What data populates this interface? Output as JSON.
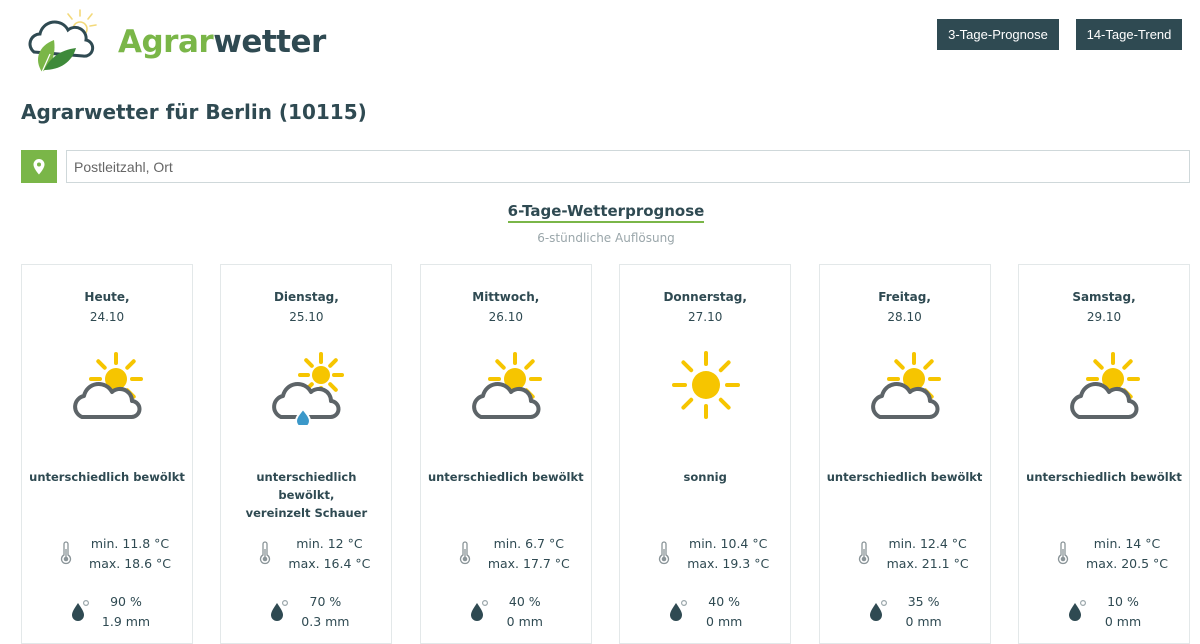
{
  "header": {
    "logo_part1": "Agrar",
    "logo_part2": "wetter",
    "btn_3day": "3-Tage-Prognose",
    "btn_14day": "14-Tage-Trend"
  },
  "page_title": "Agrarwetter für Berlin (10115)",
  "search": {
    "placeholder": "Postleitzahl, Ort",
    "location_icon": "map-pin-icon"
  },
  "forecast": {
    "title": "6-Tage-Wetterprognose",
    "subtitle": "6-stündliche Auflösung",
    "days": [
      {
        "name": "Heute,",
        "date": "24.10",
        "icon": "sun-cloud",
        "desc": [
          "unterschiedlich bewölkt"
        ],
        "tmin": "min. 11.8 °C",
        "tmax": "max. 18.6 °C",
        "rain_prob": "90 %",
        "rain_amount": "1.9 mm"
      },
      {
        "name": "Dienstag,",
        "date": "25.10",
        "icon": "sun-cloud-rain",
        "desc": [
          "unterschiedlich bewölkt,",
          "vereinzelt Schauer"
        ],
        "tmin": "min. 12 °C",
        "tmax": "max. 16.4 °C",
        "rain_prob": "70 %",
        "rain_amount": "0.3 mm"
      },
      {
        "name": "Mittwoch,",
        "date": "26.10",
        "icon": "sun-cloud",
        "desc": [
          "unterschiedlich bewölkt"
        ],
        "tmin": "min. 6.7 °C",
        "tmax": "max. 17.7 °C",
        "rain_prob": "40 %",
        "rain_amount": "0 mm"
      },
      {
        "name": "Donnerstag,",
        "date": "27.10",
        "icon": "sun",
        "desc": [
          "sonnig"
        ],
        "tmin": "min. 10.4 °C",
        "tmax": "max. 19.3 °C",
        "rain_prob": "40 %",
        "rain_amount": "0 mm"
      },
      {
        "name": "Freitag,",
        "date": "28.10",
        "icon": "sun-cloud",
        "desc": [
          "unterschiedlich bewölkt"
        ],
        "tmin": "min. 12.4 °C",
        "tmax": "max. 21.1 °C",
        "rain_prob": "35 %",
        "rain_amount": "0 mm"
      },
      {
        "name": "Samstag,",
        "date": "29.10",
        "icon": "sun-cloud",
        "desc": [
          "unterschiedlich bewölkt"
        ],
        "tmin": "min. 14 °C",
        "tmax": "max. 20.5 °C",
        "rain_prob": "10 %",
        "rain_amount": "0 mm"
      }
    ]
  },
  "colors": {
    "brand_green": "#7ab648",
    "dark": "#2f4a52",
    "sun": "#f6c500",
    "cloud": "#5d6468",
    "rain": "#3b98c9"
  }
}
